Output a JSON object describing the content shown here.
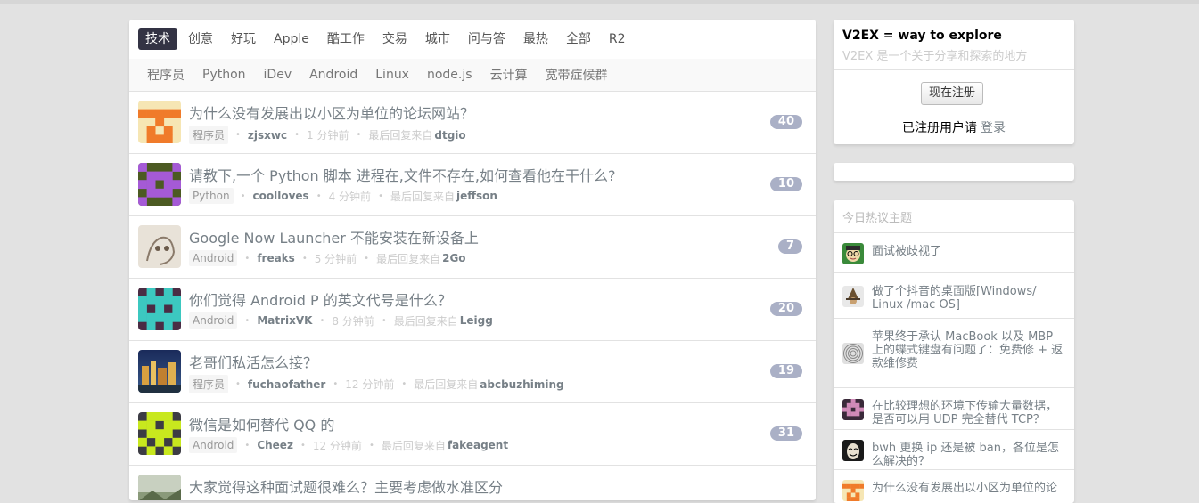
{
  "tabs": [
    "技术",
    "创意",
    "好玩",
    "Apple",
    "酷工作",
    "交易",
    "城市",
    "问与答",
    "最热",
    "全部",
    "R2"
  ],
  "active_tab": "技术",
  "subtabs": [
    "程序员",
    "Python",
    "iDev",
    "Android",
    "Linux",
    "node.js",
    "云计算",
    "宽带症候群"
  ],
  "topics": [
    {
      "title": "为什么没有发展出以小区为单位的论坛网站？",
      "node": "程序员",
      "author": "zjsxwc",
      "time": "1 分钟前",
      "last_label": "最后回复来自",
      "last_user": "dtgio",
      "count": "40",
      "avatar": "orange-pixel-avatar"
    },
    {
      "title": "请教下,一个 Python 脚本 进程在,文件不存在,如何查看他在干什么?",
      "node": "Python",
      "author": "coolloves",
      "time": "4 分钟前",
      "last_label": "最后回复来自",
      "last_user": "jeffson",
      "count": "10",
      "avatar": "purple-pixel-avatar"
    },
    {
      "title": "Google Now Launcher 不能安装在新设备上",
      "node": "Android",
      "author": "freaks",
      "time": "5 分钟前",
      "last_label": "最后回复来自",
      "last_user": "2Go",
      "count": "7",
      "avatar": "sketch-avatar"
    },
    {
      "title": "你们觉得 Android P 的英文代号是什么？",
      "node": "Android",
      "author": "MatrixVK",
      "time": "8 分钟前",
      "last_label": "最后回复来自",
      "last_user": "Leigg",
      "count": "20",
      "avatar": "teal-pixel-avatar"
    },
    {
      "title": "老哥们私活怎么接？",
      "node": "程序员",
      "author": "fuchaofather",
      "time": "12 分钟前",
      "last_label": "最后回复来自",
      "last_user": "abcbuzhiming",
      "count": "19",
      "avatar": "city-photo-avatar"
    },
    {
      "title": "微信是如何替代 QQ 的",
      "node": "Android",
      "author": "Cheez",
      "time": "12 分钟前",
      "last_label": "最后回复来自",
      "last_user": "fakeagent",
      "count": "31",
      "avatar": "lime-pixel-avatar"
    },
    {
      "title": "大家觉得这种面试题很难么？主要考虑做水准区分",
      "node": "",
      "author": "",
      "time": "",
      "last_label": "",
      "last_user": "",
      "count": "",
      "avatar": "landscape-photo-avatar"
    }
  ],
  "sidebar": {
    "brand_title": "V2EX = way to explore",
    "brand_sub": "V2EX 是一个关于分享和探索的地方",
    "signup": "现在注册",
    "login_prompt": "已注册用户请",
    "login": "登录",
    "hot_title": "今日热议主题",
    "hot": [
      {
        "text": "面试被歧视了",
        "avatar": "glasses-face-avatar"
      },
      {
        "text": "做了个抖音的桌面版[Windows/ Linux /mac OS]",
        "avatar": "wizard-avatar"
      },
      {
        "text": "苹果终于承认 MacBook 以及 MBP 上的蝶式键盘有问题了：免费修 + 返款维修费",
        "avatar": "fingerprint-avatar"
      },
      {
        "text": "在比较理想的环境下传输大量数据，是否可以用 UDP 完全替代 TCP？",
        "avatar": "pink-pixel-avatar"
      },
      {
        "text": "bwh 更换 ip 还是被 ban，各位是怎么解决的？",
        "avatar": "mask-avatar"
      },
      {
        "text": "为什么没有发展出以小区为单位的论",
        "avatar": "orange-pixel-avatar"
      }
    ]
  }
}
